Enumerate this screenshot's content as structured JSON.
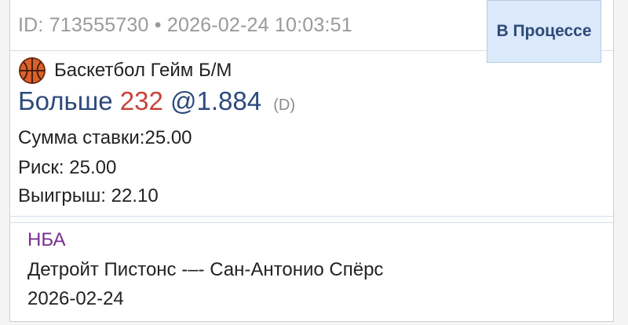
{
  "bet": {
    "id_line": "ID: 713555730 • 2026-02-24 10:03:51",
    "status": "В Процессе",
    "sport_icon": "basketball-icon",
    "market": "Баскетбол Гейм Б/М",
    "selection": "Больше",
    "line": "232",
    "odds": "@1.884",
    "odds_type": "(D)",
    "stake_label": "Сумма ставки:25.00",
    "risk_label": "Риск: 25.00",
    "win_label": "Выигрыш: 22.10"
  },
  "event": {
    "league": "НБА",
    "name": "Детройт Пистонс -–- Сан-Антонио Спёрс",
    "date": "2026-02-24"
  },
  "colors": {
    "accent_blue": "#2e4a7d",
    "line_red": "#c8423a",
    "league_purple": "#7a2f8e",
    "status_bg": "#dbe9fa"
  }
}
